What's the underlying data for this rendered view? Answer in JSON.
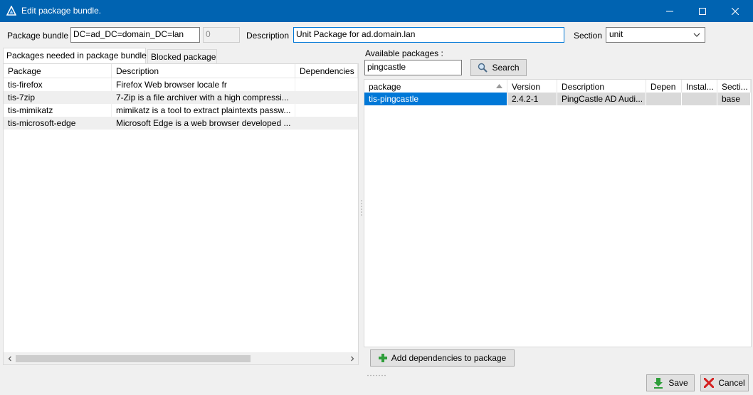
{
  "window": {
    "title": "Edit package bundle.",
    "icon": "app-triangle-icon",
    "controls": [
      "minimize-icon",
      "maximize-icon",
      "close-icon"
    ]
  },
  "form": {
    "bundle_label": "Package bundle",
    "bundle_value": "DC=ad_DC=domain_DC=lan",
    "version_value": "0",
    "description_label": "Description",
    "description_value": "Unit Package for ad.domain.lan",
    "section_label": "Section",
    "section_value": "unit"
  },
  "tabs": [
    {
      "label": "Packages needed in package bundle",
      "active": true
    },
    {
      "label": "Blocked package",
      "active": false
    }
  ],
  "bundle_grid": {
    "columns": [
      "Package",
      "Description",
      "Dependencies"
    ],
    "rows": [
      {
        "package": "tis-firefox",
        "description": "Firefox Web browser locale fr",
        "dependencies": ""
      },
      {
        "package": "tis-7zip",
        "description": "7-Zip is a file archiver with a high compressi...",
        "dependencies": ""
      },
      {
        "package": "tis-mimikatz",
        "description": "mimikatz is a tool to extract plaintexts passw...",
        "dependencies": ""
      },
      {
        "package": "tis-microsoft-edge",
        "description": "Microsoft Edge is a web browser developed ...",
        "dependencies": ""
      }
    ]
  },
  "available": {
    "label": "Available packages :",
    "search_value": "pingcastle",
    "search_button": "Search",
    "columns": [
      "package",
      "Version",
      "Description",
      "Depen",
      "Instal...",
      "Secti..."
    ],
    "rows": [
      {
        "package": "tis-pingcastle",
        "version": "2.4.2-1",
        "description": "PingCastle AD Audi...",
        "depends": "",
        "installed": "",
        "section": "base",
        "selected": true
      }
    ]
  },
  "buttons": {
    "add_dependencies": "Add dependencies to package",
    "save": "Save",
    "cancel": "Cancel"
  },
  "colors": {
    "titlebar": "#0063b1",
    "selection": "#0078d7",
    "focus_border": "#0078d7",
    "add_icon": "#2e9e3a",
    "save_icon": "#2e9e3a",
    "cancel_icon": "#d42020"
  }
}
